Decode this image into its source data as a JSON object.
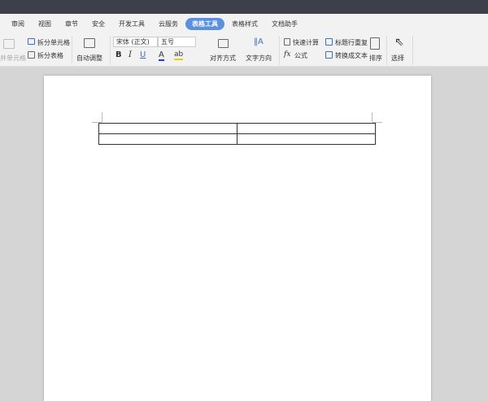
{
  "tabs": [
    {
      "label": "审阅"
    },
    {
      "label": "视图"
    },
    {
      "label": "章节"
    },
    {
      "label": "安全"
    },
    {
      "label": "开发工具"
    },
    {
      "label": "云服务"
    },
    {
      "label": "表格工具",
      "active": true
    },
    {
      "label": "表格样式"
    },
    {
      "label": "文档助手"
    }
  ],
  "ribbon": {
    "merge": "并单元格",
    "split_cell": "拆分单元格",
    "split_table": "拆分表格",
    "auto_adjust": "自动调整",
    "font": "宋体 (正文)",
    "size": "五号",
    "bold": "B",
    "italic": "I",
    "underline": "U",
    "fontcolor": "A",
    "highlight": "ab",
    "align": "对齐方式",
    "text_dir": "文字方向",
    "quick_calc": "快速计算",
    "formula": "公式",
    "fx": "fx",
    "repeat_header": "标题行重复",
    "to_text": "转换成文本",
    "sort": "排序",
    "select": "选择"
  },
  "colors": {
    "accent": "#5b8fe0",
    "titlebar": "#3d404b"
  },
  "table": {
    "rows": [
      [
        "",
        ""
      ],
      [
        "",
        ""
      ]
    ]
  }
}
